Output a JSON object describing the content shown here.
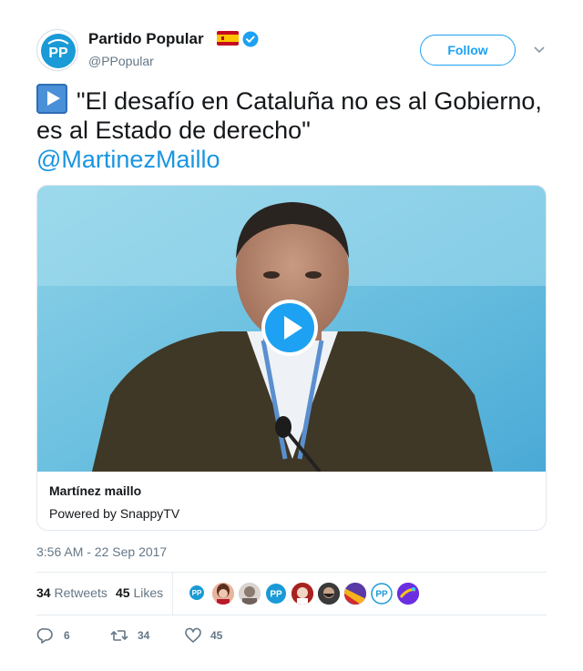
{
  "author": {
    "display_name": "Partido Popular",
    "handle": "@PPopular",
    "verified": true,
    "flag": "spain-flag-icon",
    "avatar_text": "PP"
  },
  "follow_label": "Follow",
  "tweet": {
    "emoji": "play-button-emoji",
    "text": "\"El desafío en Cataluña no es al Gobierno, es al Estado de derecho\"",
    "mention": "@MartinezMaillo"
  },
  "card": {
    "title": "Martínez maillo",
    "subtitle": "Powered by SnappyTV"
  },
  "timestamp": "3:56 AM - 22 Sep 2017",
  "stats": {
    "retweets_count": "34",
    "retweets_label": "Retweets",
    "likes_count": "45",
    "likes_label": "Likes"
  },
  "likers": [
    "pp-avatar",
    "woman-avatar",
    "woman-avatar-2",
    "pp-avatar",
    "man-avatar",
    "man-avatar-2",
    "flag-avatar",
    "pp-avatar",
    "purple-avatar"
  ],
  "actions": {
    "replies": "6",
    "retweets": "34",
    "likes": "45"
  },
  "colors": {
    "accent": "#1da1f2",
    "link": "#1b95e0",
    "muted": "#657786"
  }
}
